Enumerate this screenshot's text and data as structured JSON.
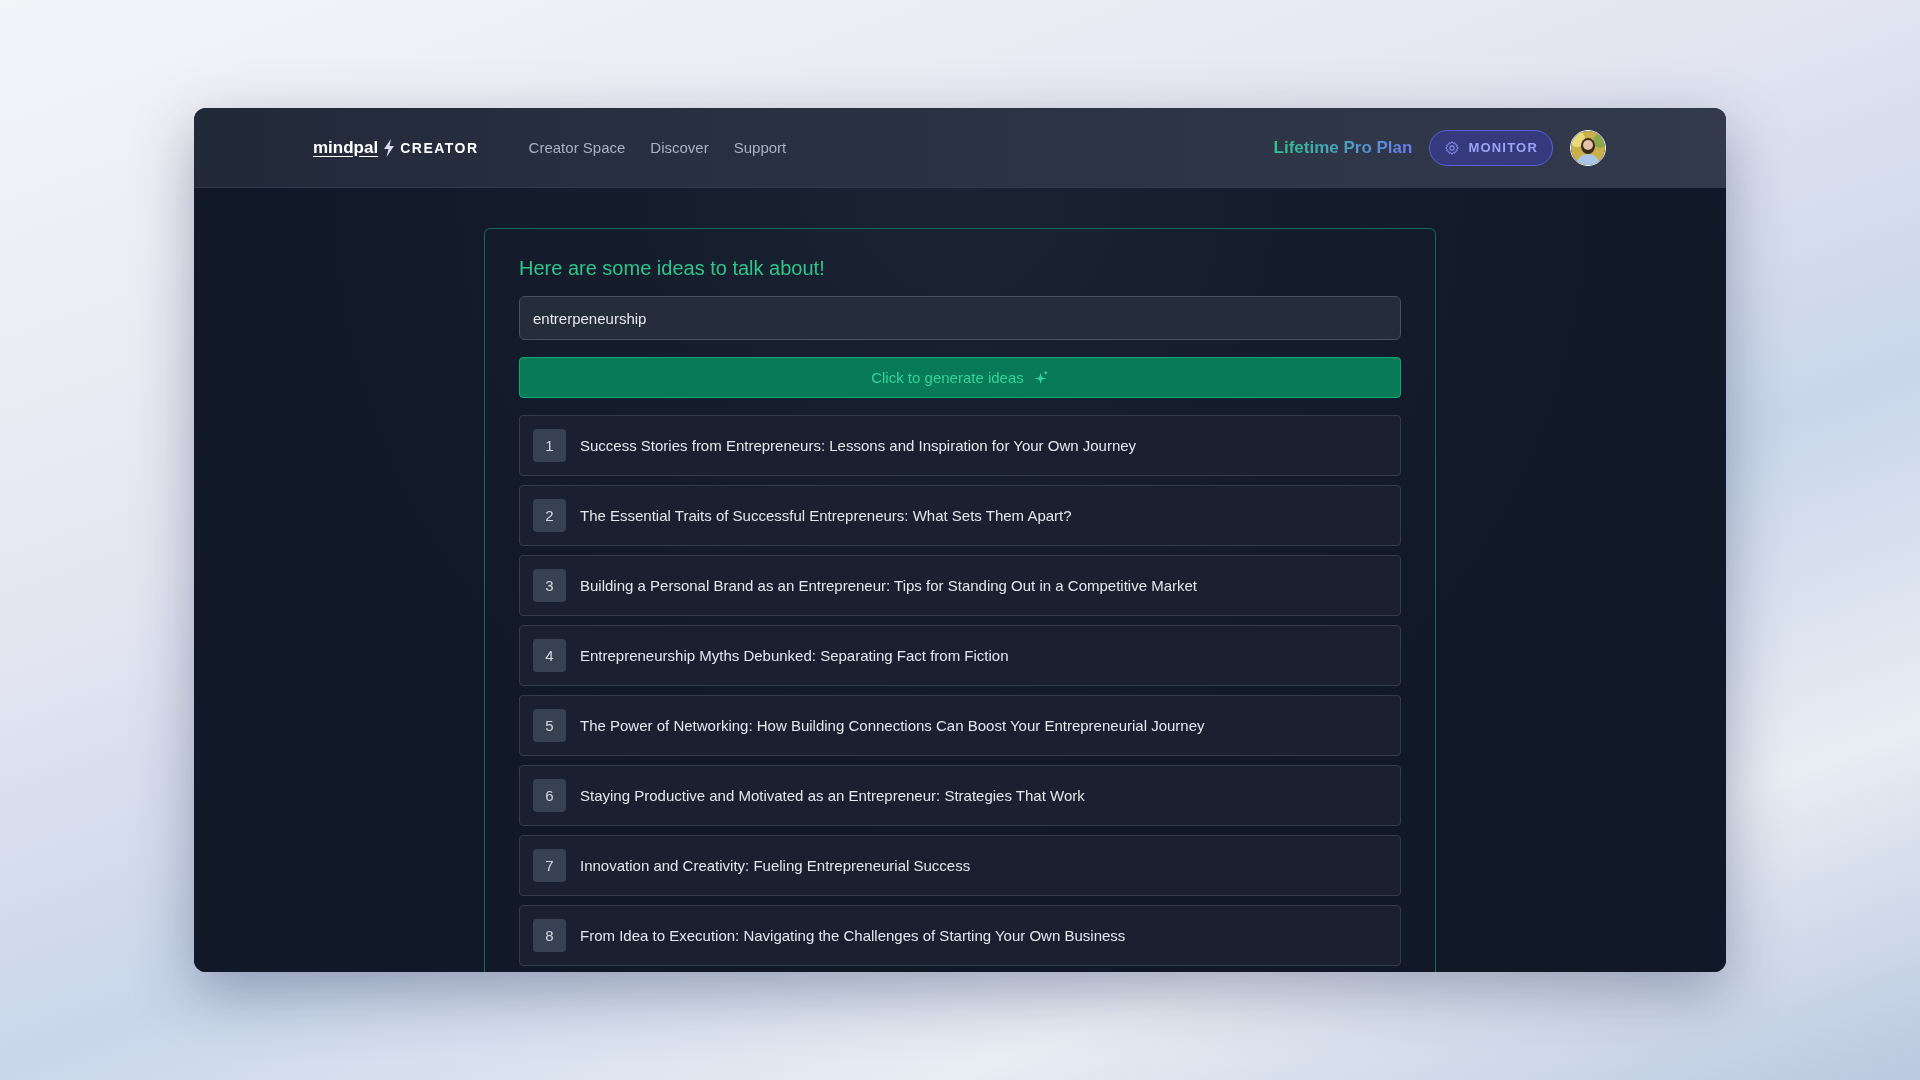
{
  "logo": {
    "word": "mindpal",
    "suffix": "CREATOR"
  },
  "nav": [
    "Creator Space",
    "Discover",
    "Support"
  ],
  "plan": "Lifetime Pro Plan",
  "monitor_button": "MONITOR",
  "card": {
    "title": "Here are some ideas to talk about!",
    "topic_field": {
      "value": "entrerpeneurship"
    },
    "generate_button": "Click to generate ideas",
    "ideas": [
      {
        "number": "1",
        "text": "Success Stories from Entrepreneurs: Lessons and Inspiration for Your Own Journey"
      },
      {
        "number": "2",
        "text": "The Essential Traits of Successful Entrepreneurs: What Sets Them Apart?"
      },
      {
        "number": "3",
        "text": "Building a Personal Brand as an Entrepreneur: Tips for Standing Out in a Competitive Market"
      },
      {
        "number": "4",
        "text": "Entrepreneurship Myths Debunked: Separating Fact from Fiction"
      },
      {
        "number": "5",
        "text": "The Power of Networking: How Building Connections Can Boost Your Entrepreneurial Journey"
      },
      {
        "number": "6",
        "text": "Staying Productive and Motivated as an Entrepreneur: Strategies That Work"
      },
      {
        "number": "7",
        "text": "Innovation and Creativity: Fueling Entrepreneurial Success"
      },
      {
        "number": "8",
        "text": "From Idea to Execution: Navigating the Challenges of Starting Your Own Business"
      }
    ]
  }
}
